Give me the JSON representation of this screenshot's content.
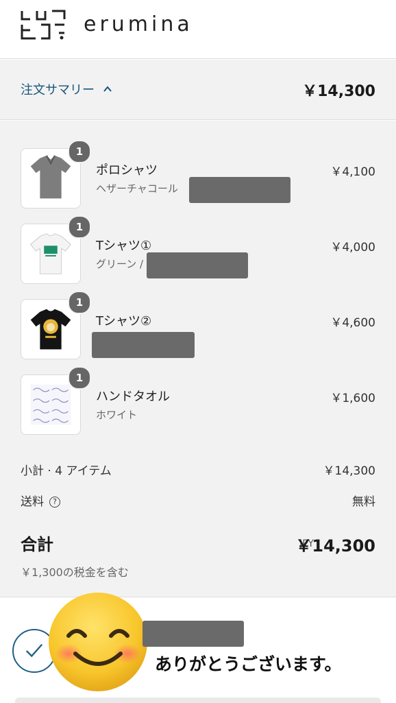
{
  "brand": {
    "logo_text": "erumina"
  },
  "summary": {
    "toggle_label": "注文サマリー",
    "total": "￥14,300"
  },
  "items": [
    {
      "name": "ポロシャツ",
      "variant": "ヘザーチャコール",
      "price": "￥4,100",
      "qty": "1",
      "icon": "polo-shirt-image"
    },
    {
      "name": "Tシャツ①",
      "variant": "グリーン /",
      "price": "￥4,000",
      "qty": "1",
      "icon": "white-tshirt-image"
    },
    {
      "name": "Tシャツ②",
      "variant": "",
      "price": "￥4,600",
      "qty": "1",
      "icon": "black-tshirt-image"
    },
    {
      "name": "ハンドタオル",
      "variant": "ホワイト",
      "price": "￥1,600",
      "qty": "1",
      "icon": "hand-towel-image"
    }
  ],
  "subtotal": {
    "label": "小計 · 4 アイテム",
    "value": "￥14,300"
  },
  "shipping": {
    "label": "送料",
    "help_glyph": "?",
    "value": "無料"
  },
  "total": {
    "label": "合計",
    "currency": "JPY",
    "value": "￥14,300"
  },
  "tax_note": "￥1,300の税金を含む",
  "confirmation": {
    "thanks": "ありがとうございます。"
  },
  "colors": {
    "accent": "#17557a",
    "panel": "#f2f2f2",
    "badge": "#666666"
  }
}
